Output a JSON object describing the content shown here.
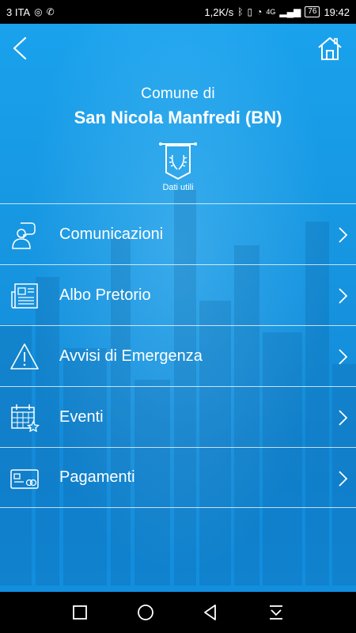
{
  "status_bar": {
    "carrier": "3 ITA",
    "speed": "1,2K/s",
    "network": "4G",
    "battery": "76",
    "time": "19:42"
  },
  "topbar": {
    "back_icon": "chevron-left-icon",
    "home_icon": "home-icon"
  },
  "header": {
    "prefix": "Comune di",
    "name": "San Nicola Manfredi (BN)",
    "banner_label": "Dati utili"
  },
  "menu": {
    "items": [
      {
        "label": "Comunicazioni",
        "icon": "person-speech-icon"
      },
      {
        "label": "Albo Pretorio",
        "icon": "newspaper-icon"
      },
      {
        "label": "Avvisi di Emergenza",
        "icon": "warning-icon"
      },
      {
        "label": "Eventi",
        "icon": "calendar-star-icon"
      },
      {
        "label": "Pagamenti",
        "icon": "credit-card-icon"
      }
    ]
  },
  "colors": {
    "background": "#1597e2",
    "text": "#ffffff",
    "bars": "#000000"
  }
}
